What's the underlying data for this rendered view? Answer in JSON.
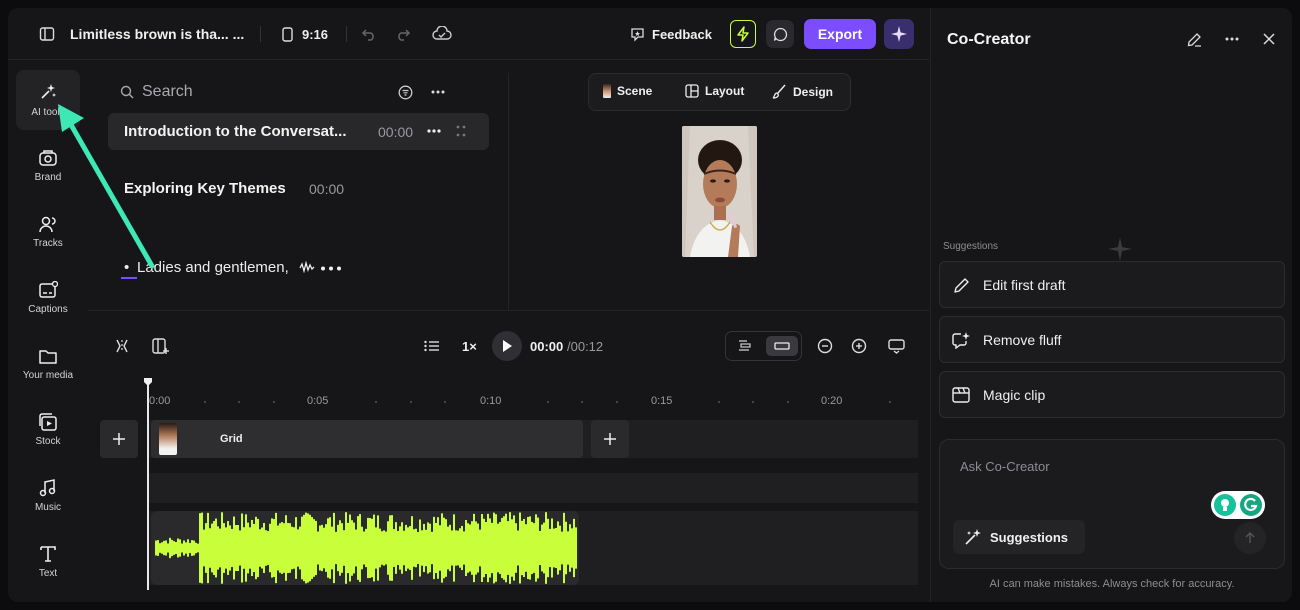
{
  "header": {
    "title": "Limitless brown is tha... ...",
    "aspect_ratio": "9:16",
    "feedback_label": "Feedback",
    "export_label": "Export"
  },
  "sidebar": {
    "items": [
      {
        "label": "AI tools",
        "icon": "sparkles-icon"
      },
      {
        "label": "Brand",
        "icon": "brand-kit-icon"
      },
      {
        "label": "Tracks",
        "icon": "tracks-icon"
      },
      {
        "label": "Captions",
        "icon": "captions-icon"
      },
      {
        "label": "Your media",
        "icon": "folder-icon"
      },
      {
        "label": "Stock",
        "icon": "stock-icon"
      },
      {
        "label": "Music",
        "icon": "music-icon"
      },
      {
        "label": "Text",
        "icon": "text-icon"
      }
    ]
  },
  "script": {
    "search_placeholder": "Search",
    "scenes": [
      {
        "title": "Introduction to the Conversat...",
        "time": "00:00"
      },
      {
        "title": "Exploring Key Themes",
        "time": "00:00"
      }
    ],
    "text_line": "Ladies and gentlemen,"
  },
  "preview": {
    "tabs": [
      "Scene",
      "Layout",
      "Design"
    ]
  },
  "timeline": {
    "speed": "1×",
    "current_time": "00:00",
    "total_time": "/00:12",
    "ticks": [
      "0:00",
      "0:05",
      "0:10",
      "0:15",
      "0:20"
    ],
    "clip_label": "Grid"
  },
  "cocreator": {
    "title": "Co-Creator",
    "suggestions_heading": "Suggestions",
    "suggestions": [
      "Edit first draft",
      "Remove fluff",
      "Magic clip"
    ],
    "input_placeholder": "Ask Co-Creator",
    "suggestions_button": "Suggestions",
    "disclaimer": "AI can make mistakes. Always check for accuracy."
  },
  "colors": {
    "accent": "#7b4dff",
    "waveform": "#c8ff3a",
    "annotation_arrow": "#3ee8b5"
  }
}
